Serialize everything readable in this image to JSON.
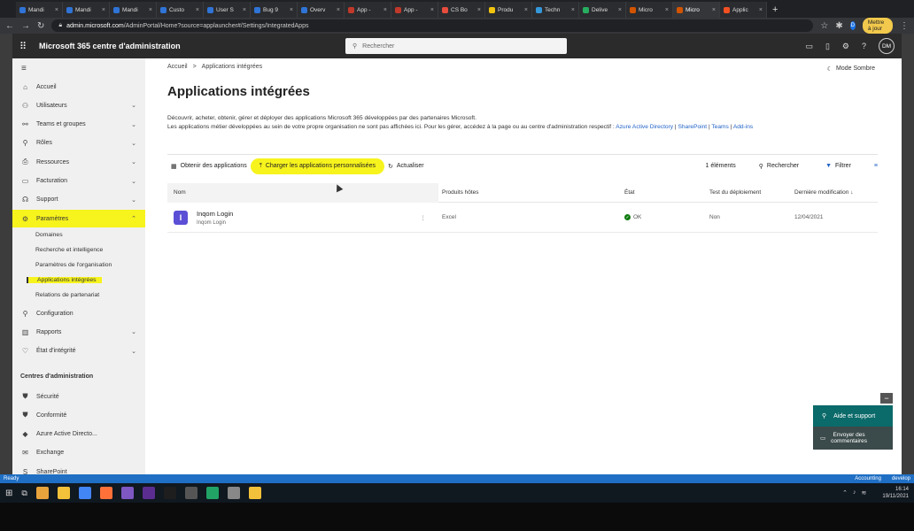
{
  "browser": {
    "tabs": [
      {
        "label": "Mandi",
        "color": "#2f74d6"
      },
      {
        "label": "Mandi",
        "color": "#2f74d6"
      },
      {
        "label": "Mandi",
        "color": "#2f74d6"
      },
      {
        "label": "Custo",
        "color": "#2f74d6"
      },
      {
        "label": "User S",
        "color": "#2f74d6"
      },
      {
        "label": "Bug 9",
        "color": "#2f74d6"
      },
      {
        "label": "Overv",
        "color": "#2f74d6"
      },
      {
        "label": "App -",
        "color": "#c0392b"
      },
      {
        "label": "App -",
        "color": "#c0392b"
      },
      {
        "label": "CS Bo",
        "color": "#e74c3c"
      },
      {
        "label": "Produ",
        "color": "#f1c40f"
      },
      {
        "label": "Techn",
        "color": "#3498db"
      },
      {
        "label": "Delive",
        "color": "#27ae60"
      },
      {
        "label": "Micro",
        "color": "#d35400"
      },
      {
        "label": "Micro",
        "color": "#d35400",
        "active": true
      },
      {
        "label": "Applic",
        "color": "#f25022"
      }
    ],
    "url_domain": "admin.microsoft.com",
    "url_path": "/AdminPortal/Home?source=applauncher#/Settings/IntegratedApps",
    "update_label": "Mettre à jour",
    "profile_initial": "D"
  },
  "header": {
    "app_title": "Microsoft 365 centre d'administration",
    "search_placeholder": "Rechercher",
    "avatar_initials": "DM"
  },
  "sidebar": {
    "items": [
      {
        "label": "Accueil",
        "icon": "⌂"
      },
      {
        "label": "Utilisateurs",
        "icon": "⚇",
        "chevron": "⌄"
      },
      {
        "label": "Teams et groupes",
        "icon": "⚯",
        "chevron": "⌄"
      },
      {
        "label": "Rôles",
        "icon": "⚲",
        "chevron": "⌄"
      },
      {
        "label": "Ressources",
        "icon": "⎙",
        "chevron": "⌄"
      },
      {
        "label": "Facturation",
        "icon": "▭",
        "chevron": "⌄"
      },
      {
        "label": "Support",
        "icon": "☊",
        "chevron": "⌄"
      },
      {
        "label": "Paramètres",
        "icon": "⚙",
        "chevron": "⌃"
      }
    ],
    "sub_items": [
      "Domaines",
      "Recherche et intelligence",
      "Paramètres de l'organisation",
      "Applications intégrées",
      "Relations de partenariat"
    ],
    "items2": [
      {
        "label": "Configuration",
        "icon": "⚲"
      },
      {
        "label": "Rapports",
        "icon": "▥",
        "chevron": "⌄"
      },
      {
        "label": "État d'intégrité",
        "icon": "♡",
        "chevron": "⌄"
      }
    ],
    "section_header": "Centres d'administration",
    "admin_centers": [
      {
        "label": "Sécurité",
        "icon": "⛊"
      },
      {
        "label": "Conformité",
        "icon": "⛊"
      },
      {
        "label": "Azure Active Directo...",
        "icon": "◆"
      },
      {
        "label": "Exchange",
        "icon": "✉"
      },
      {
        "label": "SharePoint",
        "icon": "S"
      }
    ]
  },
  "main": {
    "breadcrumb": [
      "Accueil",
      "Applications intégrées"
    ],
    "breadcrumb_sep": ">",
    "mode_sombre": "Mode Sombre",
    "title": "Applications intégrées",
    "desc_line1": "Découvrir, acheter, obtenir, gérer et déployer des applications Microsoft 365 développées par des partenaires Microsoft.",
    "desc_line2": "Les applications métier développées au sein de votre propre organisation ne sont pas affichées ici. Pour les gérer, accédez à la page ou au centre d'administration respectif :",
    "desc_links": [
      "Azure Active Directory",
      "SharePoint",
      "Teams",
      "Add-ins"
    ],
    "commands": {
      "get_apps": "Obtenir des applications",
      "upload": "Charger les applications personnalisées",
      "refresh": "Actualiser",
      "count": "1 éléments",
      "search": "Rechercher",
      "filter": "Filtrer"
    },
    "columns": [
      "Nom",
      "Produits hôtes",
      "État",
      "Test du déploiement",
      "Dernière modification ↓"
    ],
    "rows": [
      {
        "name": "Inqom Login",
        "publisher": "Inqom Login",
        "host": "Excel",
        "status": "OK",
        "test": "Non",
        "modified": "12/04/2021",
        "icon_letter": "I"
      }
    ]
  },
  "help": {
    "help_label": "Aide et support",
    "feedback_line1": "Envoyer des",
    "feedback_line2": "commentaires"
  },
  "statusbar": {
    "left": "Ready",
    "account": "Accounting",
    "branch": "develop"
  },
  "taskbar": {
    "time": "16:14",
    "date": "19/11/2021",
    "icon_colors": [
      "#e8a33d",
      "#f3c13a",
      "#4285f4",
      "#ff7139",
      "#7e57c2",
      "#5c2d91",
      "#1e1e1e",
      "#555",
      "#21a366",
      "#888",
      "#f3c13a"
    ]
  }
}
